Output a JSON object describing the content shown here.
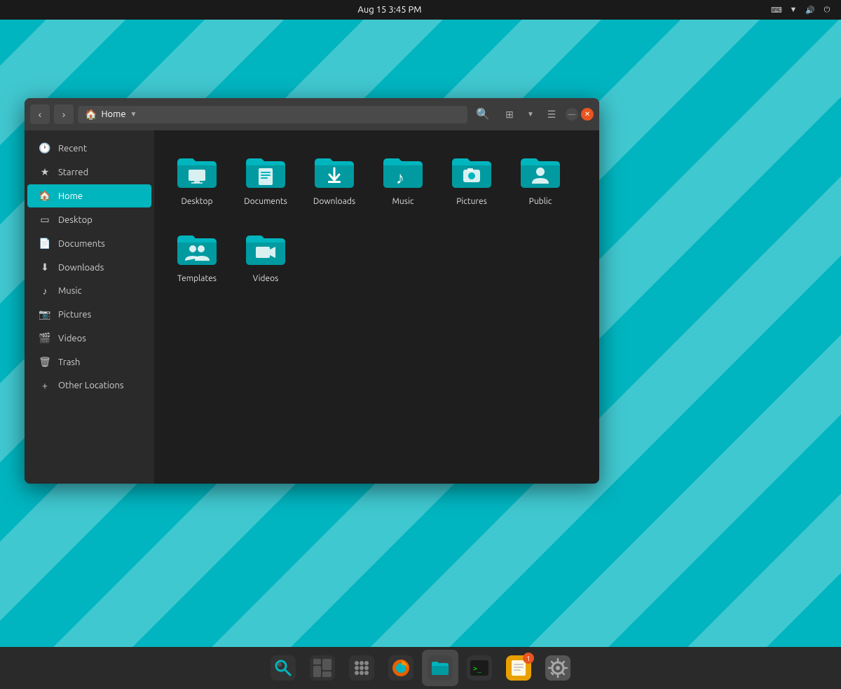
{
  "topPanel": {
    "datetime": "Aug 15  3:45 PM"
  },
  "fileManager": {
    "title": "Home",
    "locationLabel": "Home",
    "sidebar": {
      "items": [
        {
          "id": "recent",
          "label": "Recent",
          "icon": "🕐"
        },
        {
          "id": "starred",
          "label": "Starred",
          "icon": "★"
        },
        {
          "id": "home",
          "label": "Home",
          "icon": "🏠",
          "active": true
        },
        {
          "id": "desktop",
          "label": "Desktop",
          "icon": "□"
        },
        {
          "id": "documents",
          "label": "Documents",
          "icon": "📄"
        },
        {
          "id": "downloads",
          "label": "Downloads",
          "icon": "⬇"
        },
        {
          "id": "music",
          "label": "Music",
          "icon": "♪"
        },
        {
          "id": "pictures",
          "label": "Pictures",
          "icon": "📷"
        },
        {
          "id": "videos",
          "label": "Videos",
          "icon": "🎬"
        },
        {
          "id": "trash",
          "label": "Trash",
          "icon": "🗑"
        },
        {
          "id": "other-locations",
          "label": "Other Locations",
          "icon": "+"
        }
      ]
    },
    "folders": [
      {
        "id": "desktop",
        "label": "Desktop",
        "type": "desktop"
      },
      {
        "id": "documents",
        "label": "Documents",
        "type": "documents"
      },
      {
        "id": "downloads",
        "label": "Downloads",
        "type": "downloads"
      },
      {
        "id": "music",
        "label": "Music",
        "type": "music"
      },
      {
        "id": "pictures",
        "label": "Pictures",
        "type": "pictures"
      },
      {
        "id": "public",
        "label": "Public",
        "type": "public"
      },
      {
        "id": "templates",
        "label": "Templates",
        "type": "templates"
      },
      {
        "id": "videos",
        "label": "Videos",
        "type": "videos"
      }
    ]
  },
  "taskbar": {
    "items": [
      {
        "id": "search",
        "label": "Search",
        "icon": "🔍"
      },
      {
        "id": "window-manager",
        "label": "Window Manager",
        "icon": "⊞"
      },
      {
        "id": "app-grid",
        "label": "App Grid",
        "icon": "⠿"
      },
      {
        "id": "firefox",
        "label": "Firefox",
        "icon": "🦊"
      },
      {
        "id": "files",
        "label": "Files",
        "icon": "📁",
        "active": true
      },
      {
        "id": "terminal",
        "label": "Terminal",
        "icon": ">"
      },
      {
        "id": "notes",
        "label": "Notes",
        "icon": "📝",
        "badge": "1"
      },
      {
        "id": "settings",
        "label": "Settings",
        "icon": "⚙"
      }
    ]
  }
}
